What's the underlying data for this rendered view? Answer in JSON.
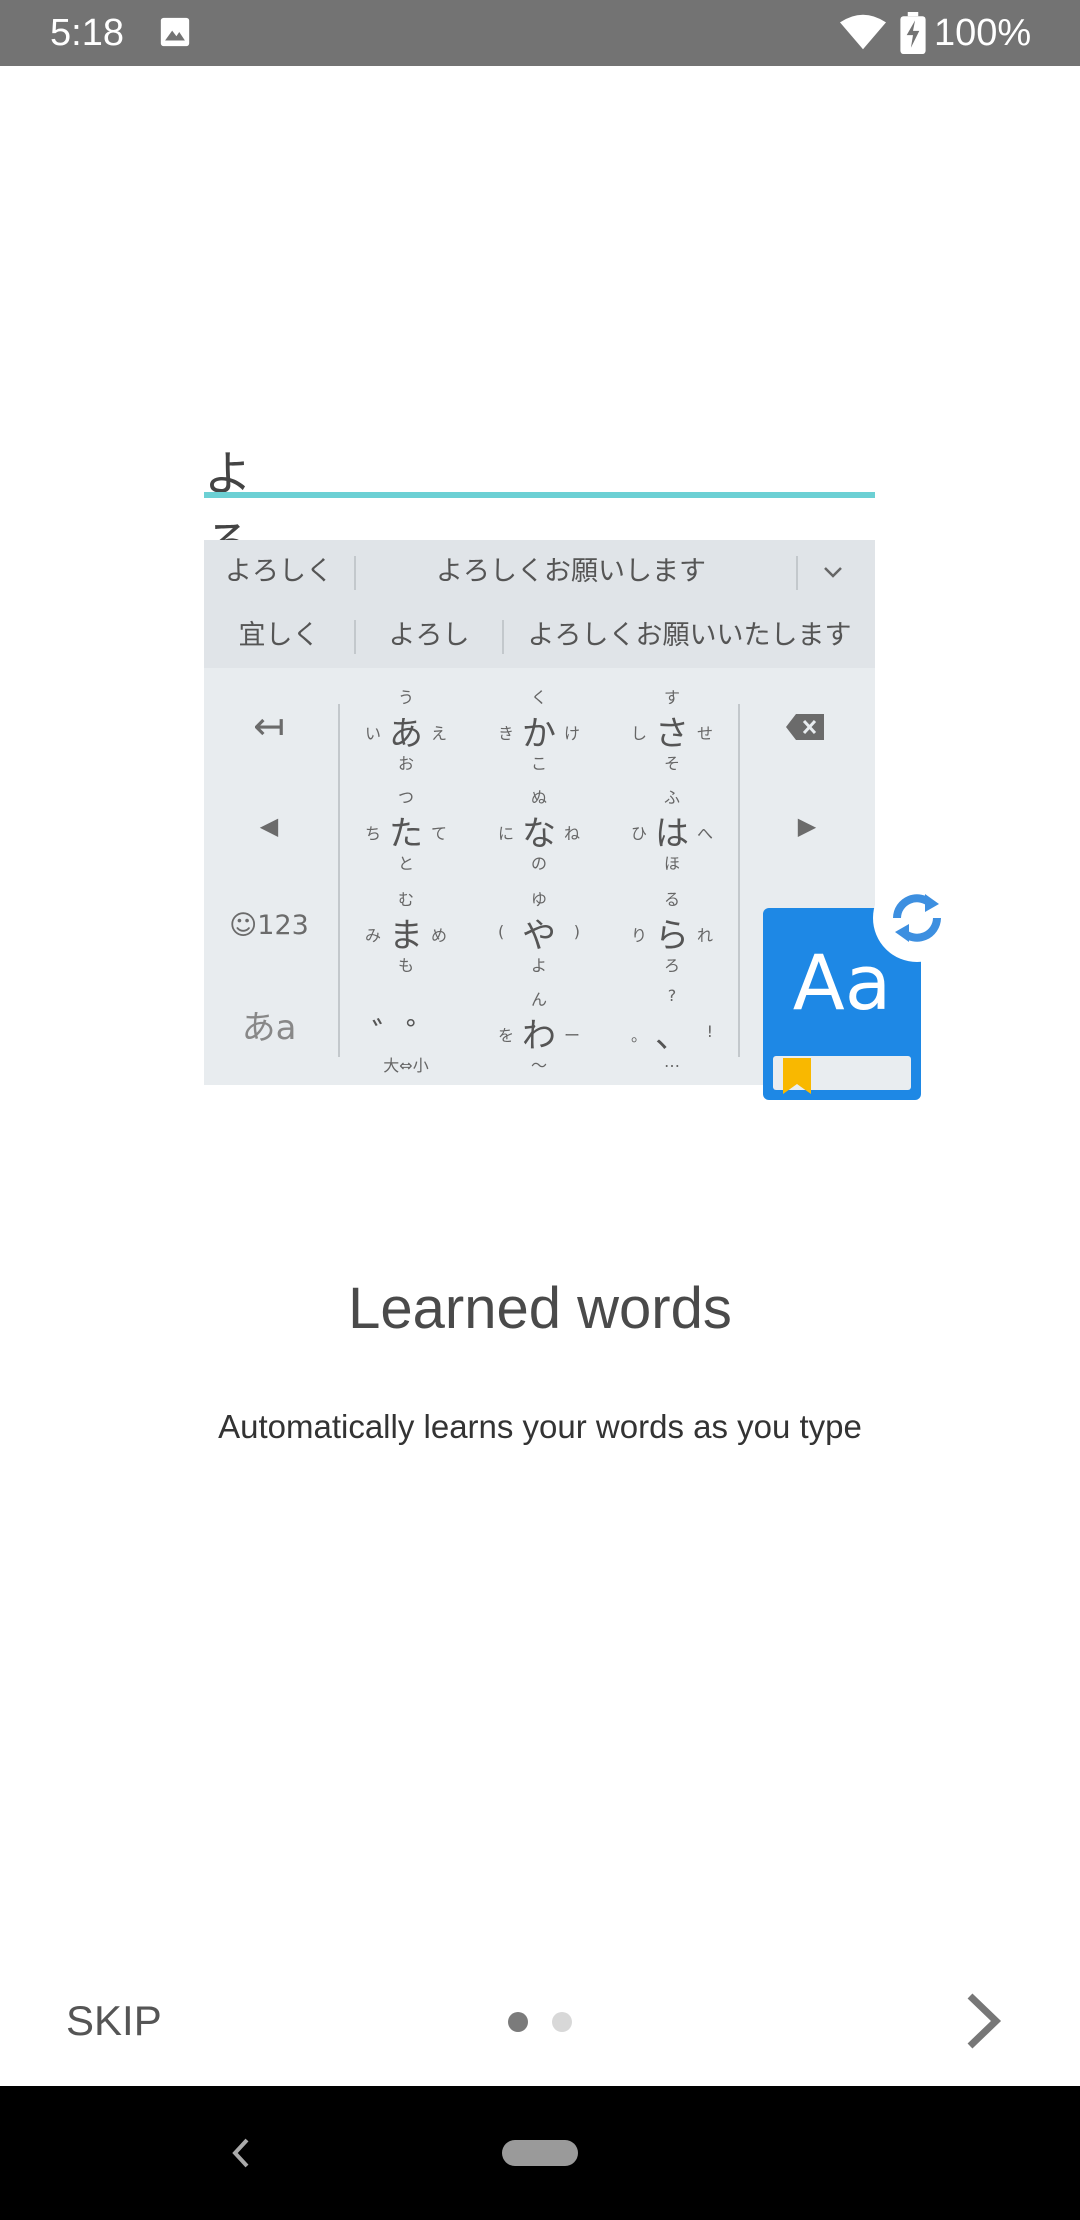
{
  "status_bar": {
    "time": "5:18",
    "battery": "100%",
    "icons": [
      "image-icon",
      "wifi-icon",
      "battery-charging-icon"
    ]
  },
  "illustration": {
    "typed_text": "よろし",
    "candidates_row1": [
      "よろしく",
      "よろしくお願いします"
    ],
    "candidates_row2": [
      "宜しく",
      "よろし",
      "よろしくお願いいたします"
    ],
    "keys": {
      "undo": "↤",
      "left": "◀",
      "right": "▶",
      "emoji_num": "☺123",
      "kana_toggle": "あa",
      "kana": [
        {
          "main": "あ",
          "top": "う",
          "left": "い",
          "right": "え",
          "bottom": "お"
        },
        {
          "main": "か",
          "top": "く",
          "left": "き",
          "right": "け",
          "bottom": "こ"
        },
        {
          "main": "さ",
          "top": "す",
          "left": "し",
          "right": "せ",
          "bottom": "そ"
        },
        {
          "main": "た",
          "top": "つ",
          "left": "ち",
          "right": "て",
          "bottom": "と"
        },
        {
          "main": "な",
          "top": "ぬ",
          "left": "に",
          "right": "ね",
          "bottom": "の"
        },
        {
          "main": "は",
          "top": "ふ",
          "left": "ひ",
          "right": "へ",
          "bottom": "ほ"
        },
        {
          "main": "ま",
          "top": "む",
          "left": "み",
          "right": "め",
          "bottom": "も"
        },
        {
          "main": "や",
          "top": "ゆ",
          "left": "(",
          "right": ")",
          "bottom": "よ"
        },
        {
          "main": "ら",
          "top": "る",
          "left": "り",
          "right": "れ",
          "bottom": "ろ"
        },
        {
          "main": "゛゜",
          "top": "",
          "left": "",
          "right": "",
          "bottom": "大⇔小"
        },
        {
          "main": "わ",
          "top": "ん",
          "left": "を",
          "right": "ー",
          "bottom": "〜"
        },
        {
          "main": "、",
          "top": "?",
          "left": "。",
          "right": "!",
          "bottom": "…"
        }
      ]
    },
    "dictionary_icon_text": "Aa",
    "colors": {
      "accent_teal": "#6cd0d4",
      "dictionary_blue": "#1e88e5",
      "bookmark_yellow": "#f9b800"
    }
  },
  "content": {
    "title": "Learned words",
    "subtitle": "Automatically learns your words as you type"
  },
  "footer": {
    "skip_label": "SKIP",
    "page_index": 1,
    "page_count": 2
  }
}
